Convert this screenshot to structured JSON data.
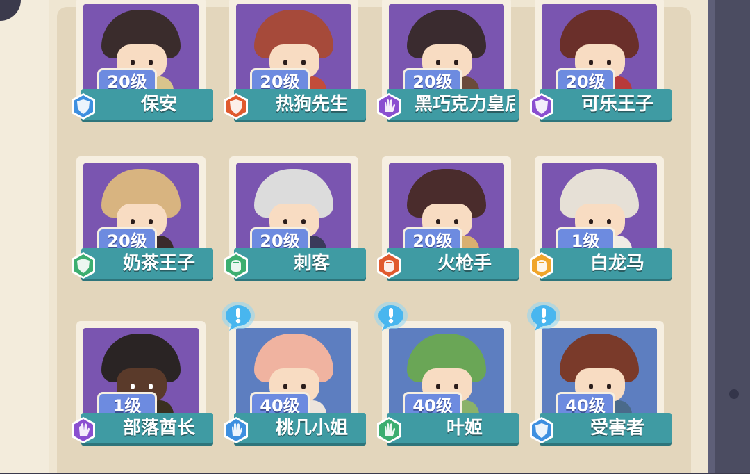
{
  "screen": "character roster",
  "colors": {
    "portrait_purple": "#7a55b0",
    "portrait_blue": "#5d7ec0",
    "name_bar": "#3f9ba3",
    "level_badge": "#6d8be0",
    "rarity_blue": "#3d8fe0",
    "rarity_red": "#e05a2e",
    "rarity_purple": "#8a4fd0",
    "rarity_green": "#3cae70",
    "rarity_gold": "#f0a52a"
  },
  "characters": [
    {
      "name": "保安",
      "level": "20级",
      "rarity": "blue",
      "rarity_icon": "shield-icon",
      "alert": false
    },
    {
      "name": "热狗先生",
      "level": "20级",
      "rarity": "red",
      "rarity_icon": "shield-icon",
      "alert": false
    },
    {
      "name": "黑巧克力皇后",
      "level": "20级",
      "rarity": "purple",
      "rarity_icon": "hand-icon",
      "alert": false
    },
    {
      "name": "可乐王子",
      "level": "20级",
      "rarity": "purple",
      "rarity_icon": "shield-icon",
      "alert": false
    },
    {
      "name": "奶茶王子",
      "level": "20级",
      "rarity": "green",
      "rarity_icon": "shield-icon",
      "alert": false
    },
    {
      "name": "刺客",
      "level": "20级",
      "rarity": "green",
      "rarity_icon": "fist-icon",
      "alert": false
    },
    {
      "name": "火枪手",
      "level": "20级",
      "rarity": "red",
      "rarity_icon": "fist-icon",
      "alert": false
    },
    {
      "name": "白龙马",
      "level": "1级",
      "rarity": "gold",
      "rarity_icon": "fist-icon",
      "alert": false
    },
    {
      "name": "部落酋长",
      "level": "1级",
      "rarity": "purple",
      "rarity_icon": "hand-icon",
      "alert": false
    },
    {
      "name": "桃几小姐",
      "level": "40级",
      "rarity": "blue",
      "rarity_icon": "hand-icon",
      "alert": true
    },
    {
      "name": "叶姬",
      "level": "40级",
      "rarity": "green",
      "rarity_icon": "hand-icon",
      "alert": true
    },
    {
      "name": "受害者",
      "level": "40级",
      "rarity": "blue",
      "rarity_icon": "shield-icon",
      "alert": true
    }
  ],
  "alert_icon": "exclamation-bubble-icon"
}
